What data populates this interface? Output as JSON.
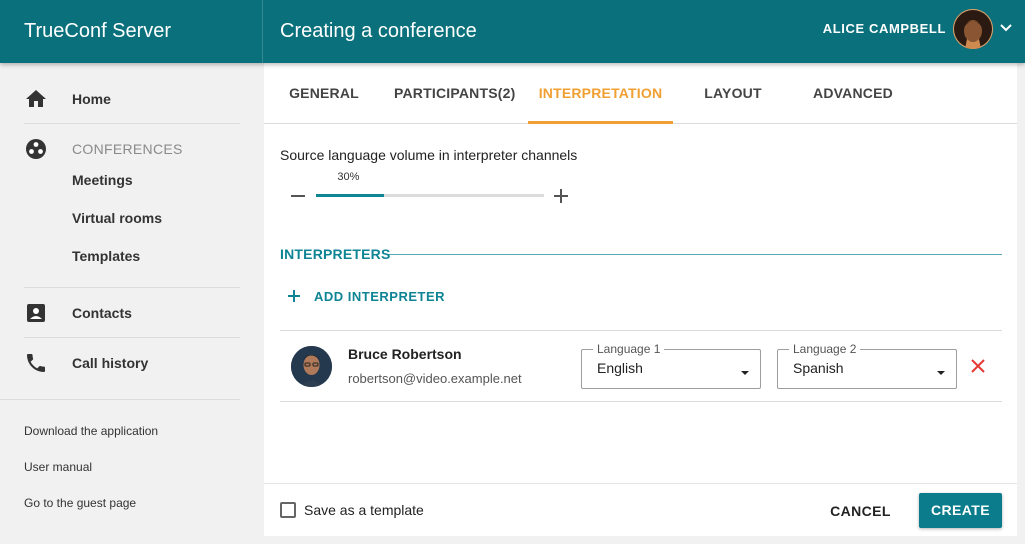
{
  "header": {
    "brand": "TrueConf Server",
    "title": "Creating a conference",
    "user_name": "ALICE CAMPBELL",
    "user_avatar_icon": "user-avatar",
    "menu_icon": "chevron-down-icon"
  },
  "sidebar": {
    "home": {
      "label": "Home",
      "icon": "home-icon"
    },
    "conferences": {
      "label": "CONFERENCES",
      "icon": "conference-group-icon"
    },
    "sub_items": [
      "Meetings",
      "Virtual rooms",
      "Templates"
    ],
    "contacts": {
      "label": "Contacts",
      "icon": "contact-book-icon"
    },
    "call_history": {
      "label": "Call history",
      "icon": "phone-icon"
    },
    "footer_links": [
      "Download the application",
      "User manual",
      "Go to the guest page"
    ]
  },
  "tabs": [
    "GENERAL",
    "PARTICIPANTS(2)",
    "INTERPRETATION",
    "LAYOUT",
    "ADVANCED"
  ],
  "active_tab": "INTERPRETATION",
  "volume": {
    "label": "Source language volume in interpreter channels",
    "value_text": "30%",
    "value": 30
  },
  "interpreters": {
    "section_title": "INTERPRETERS",
    "add_label": "ADD INTERPRETER",
    "rows": [
      {
        "name": "Bruce Robertson",
        "email": "robertson@video.example.net",
        "language1_label": "Language 1",
        "language1_value": "English",
        "language2_label": "Language 2",
        "language2_value": "Spanish"
      }
    ]
  },
  "footer": {
    "save_template_label": "Save as a template",
    "save_template_checked": false,
    "cancel_label": "CANCEL",
    "create_label": "CREATE"
  },
  "colors": {
    "header": "#0a707c",
    "accent_teal": "#0f8494",
    "active_tab": "#f0a032",
    "remove": "#e53935"
  }
}
